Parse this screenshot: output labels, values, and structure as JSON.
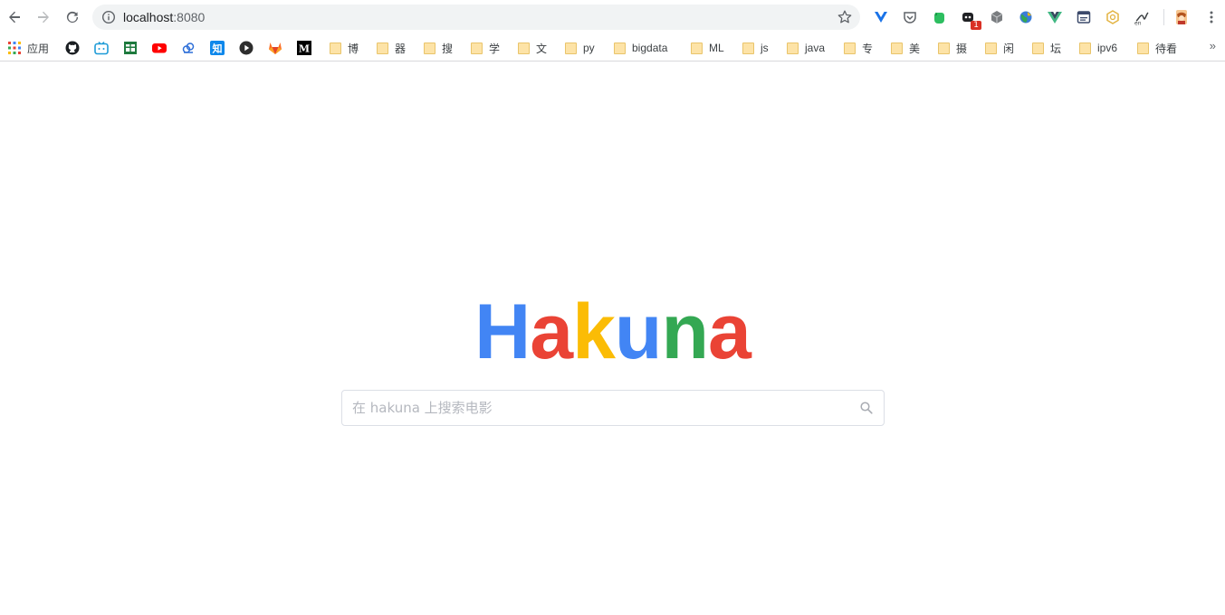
{
  "browser": {
    "url_host": "localhost",
    "url_port": ":8080"
  },
  "extensions": [
    {
      "name": "vue-extension-icon"
    },
    {
      "name": "pocket-icon"
    },
    {
      "name": "evernote-icon"
    },
    {
      "name": "notification-extension-icon",
      "badge": "1"
    },
    {
      "name": "cube-icon"
    },
    {
      "name": "globe-icon"
    },
    {
      "name": "vue-devtools-icon"
    },
    {
      "name": "window-icon"
    },
    {
      "name": "hexagon-icon"
    },
    {
      "name": "translate-icon"
    },
    {
      "name": "profile-avatar-icon"
    }
  ],
  "bookmarks": [
    {
      "label": "应用",
      "icon": "apps-grid-icon"
    },
    {
      "label": "",
      "icon": "github-icon"
    },
    {
      "label": "",
      "icon": "bilibili-icon"
    },
    {
      "label": "",
      "icon": "book-icon"
    },
    {
      "label": "",
      "icon": "youtube-icon"
    },
    {
      "label": "",
      "icon": "cloud-icon"
    },
    {
      "label": "",
      "icon": "zhihu-icon"
    },
    {
      "label": "",
      "icon": "play-circle-icon"
    },
    {
      "label": "",
      "icon": "gitlab-icon"
    },
    {
      "label": "",
      "icon": "medium-icon"
    },
    {
      "label": "博",
      "icon": "folder-icon"
    },
    {
      "label": "器",
      "icon": "folder-icon"
    },
    {
      "label": "搜",
      "icon": "folder-icon"
    },
    {
      "label": "学",
      "icon": "folder-icon"
    },
    {
      "label": "文",
      "icon": "folder-icon"
    },
    {
      "label": "py",
      "icon": "folder-icon"
    },
    {
      "label": "bigdata",
      "icon": "folder-icon"
    },
    {
      "label": "ML",
      "icon": "folder-icon"
    },
    {
      "label": "js",
      "icon": "folder-icon"
    },
    {
      "label": "java",
      "icon": "folder-icon"
    },
    {
      "label": "专",
      "icon": "folder-icon"
    },
    {
      "label": "美",
      "icon": "folder-icon"
    },
    {
      "label": "摄",
      "icon": "folder-icon"
    },
    {
      "label": "闲",
      "icon": "folder-icon"
    },
    {
      "label": "坛",
      "icon": "folder-icon"
    },
    {
      "label": "ipv6",
      "icon": "folder-icon"
    },
    {
      "label": "待看",
      "icon": "folder-icon"
    }
  ],
  "bookmarks_more": "»",
  "page": {
    "logo_letters": [
      {
        "char": "H",
        "color": "#4285f4"
      },
      {
        "char": "a",
        "color": "#ea4335"
      },
      {
        "char": "k",
        "color": "#fbbc05"
      },
      {
        "char": "u",
        "color": "#4285f4"
      },
      {
        "char": "n",
        "color": "#34a853"
      },
      {
        "char": "a",
        "color": "#ea4335"
      }
    ],
    "search_placeholder": "在 hakuna 上搜索电影",
    "search_value": ""
  }
}
